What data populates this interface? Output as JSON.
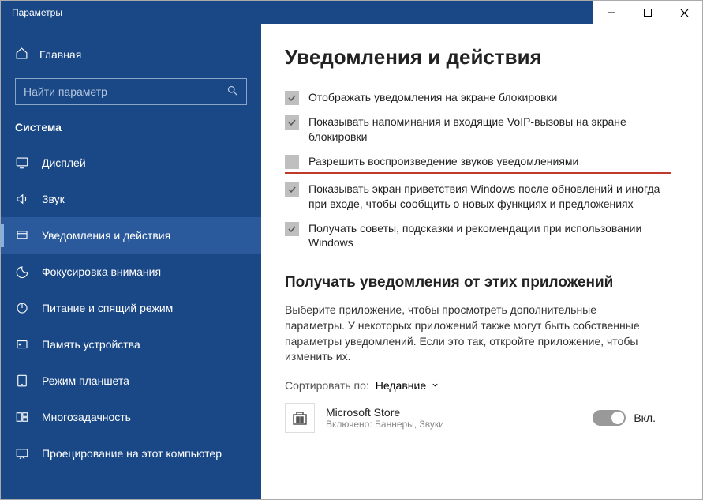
{
  "window_title": "Параметры",
  "sidebar": {
    "home": "Главная",
    "search_placeholder": "Найти параметр",
    "section": "Система",
    "items": [
      {
        "label": "Дисплей"
      },
      {
        "label": "Звук"
      },
      {
        "label": "Уведомления и действия"
      },
      {
        "label": "Фокусировка внимания"
      },
      {
        "label": "Питание и спящий режим"
      },
      {
        "label": "Память устройства"
      },
      {
        "label": "Режим планшета"
      },
      {
        "label": "Многозадачность"
      },
      {
        "label": "Проецирование на этот компьютер"
      }
    ]
  },
  "main": {
    "title": "Уведомления и действия",
    "checks": [
      {
        "checked": true,
        "label": "Отображать уведомления на экране блокировки"
      },
      {
        "checked": true,
        "label": "Показывать напоминания и входящие VoIP-вызовы на экране блокировки"
      },
      {
        "checked": false,
        "label": "Разрешить  воспроизведение звуков уведомлениями",
        "highlight": true
      },
      {
        "checked": true,
        "label": "Показывать экран приветствия Windows после обновлений и иногда при входе, чтобы сообщить о новых функциях и предложениях"
      },
      {
        "checked": true,
        "label": "Получать советы, подсказки и рекомендации при использовании Windows"
      }
    ],
    "section2_title": "Получать уведомления от этих приложений",
    "section2_desc": "Выберите приложение, чтобы просмотреть дополнительные параметры. У некоторых приложений также могут быть собственные параметры уведомлений. Если это так, откройте приложение, чтобы изменить их.",
    "sort_label": "Сортировать по:",
    "sort_value": "Недавние",
    "app": {
      "name": "Microsoft Store",
      "meta": "Включено: Баннеры, Звуки",
      "toggle_state": "Вкл."
    }
  }
}
